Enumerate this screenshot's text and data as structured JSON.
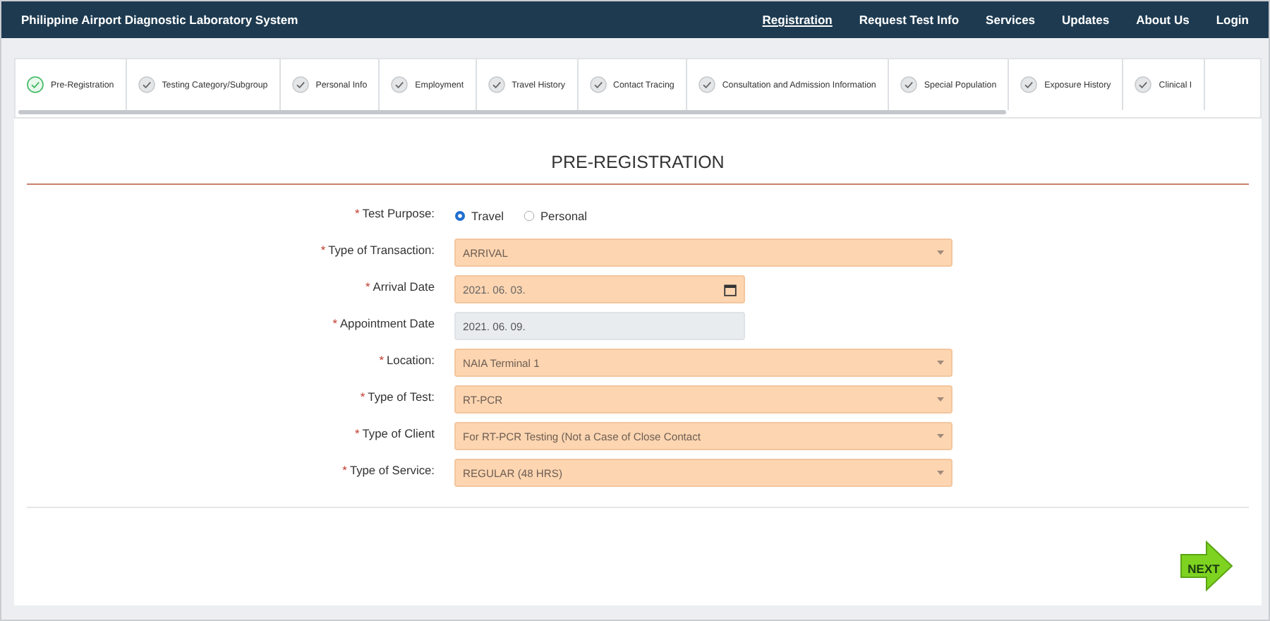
{
  "navbar": {
    "title": "Philippine Airport Diagnostic Laboratory System",
    "links": [
      {
        "label": "Registration",
        "selected": true
      },
      {
        "label": "Request Test Info",
        "selected": false
      },
      {
        "label": "Services",
        "selected": false
      },
      {
        "label": "Updates",
        "selected": false
      },
      {
        "label": "About Us",
        "selected": false
      },
      {
        "label": "Login",
        "selected": false
      }
    ]
  },
  "steps": [
    {
      "label": "Pre-Registration",
      "selected": true
    },
    {
      "label": "Testing Category/Subgroup",
      "selected": false
    },
    {
      "label": "Personal Info",
      "selected": false
    },
    {
      "label": "Employment",
      "selected": false
    },
    {
      "label": "Travel History",
      "selected": false
    },
    {
      "label": "Contact Tracing",
      "selected": false
    },
    {
      "label": "Consultation and Admission Information",
      "selected": false
    },
    {
      "label": "Special Population",
      "selected": false
    },
    {
      "label": "Exposure History",
      "selected": false
    },
    {
      "label": "Clinical I",
      "selected": false
    }
  ],
  "form": {
    "title": "PRE-REGISTRATION",
    "fields": [
      {
        "kind": "radio",
        "marker": "*",
        "label": "Test Purpose:",
        "options": [
          {
            "label": "Travel",
            "selected": true
          },
          {
            "label": "Personal",
            "selected": false
          }
        ]
      },
      {
        "kind": "select",
        "marker": "*",
        "label": "Type of Transaction:",
        "value": "ARRIVAL"
      },
      {
        "kind": "date",
        "marker": "*",
        "label": "Arrival Date",
        "value": "2021. 06. 03."
      },
      {
        "kind": "readonly",
        "marker": "*",
        "label": "Appointment Date",
        "value": "2021. 06. 09."
      },
      {
        "kind": "select",
        "marker": "*",
        "label": "Location:",
        "value": "NAIA Terminal 1"
      },
      {
        "kind": "select",
        "marker": "*",
        "label": "Type of Test:",
        "value": "RT-PCR"
      },
      {
        "kind": "select",
        "marker": "*",
        "label": "Type of Client",
        "value": "For RT-PCR Testing (Not a Case of Close Contact"
      },
      {
        "kind": "select",
        "marker": "*",
        "label": "Type of Service:",
        "value": "REGULAR (48 HRS)"
      }
    ]
  },
  "next_button": {
    "label": "NEXT"
  }
}
